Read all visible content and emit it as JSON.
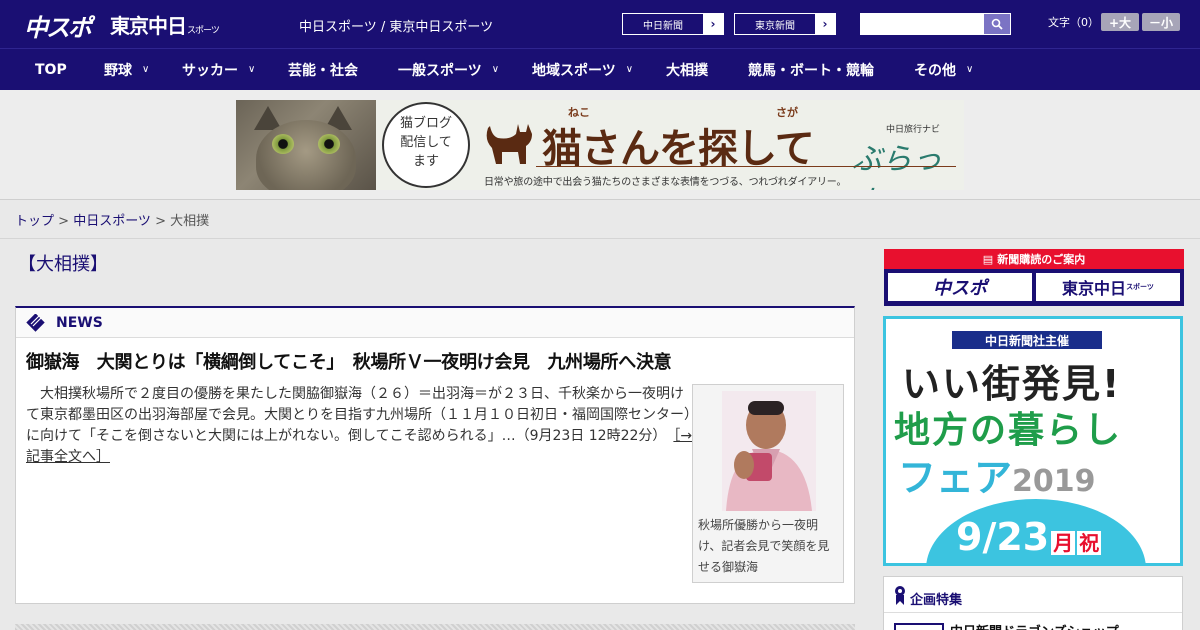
{
  "header": {
    "logo_chuspo": "中スポ",
    "logo_tokyo": "東京中日",
    "logo_tokyo_small": "スポーツ",
    "site_links": "中日スポーツ / 東京中日スポーツ",
    "site_buttons": [
      "中日新聞",
      "東京新聞"
    ],
    "search_placeholder": "",
    "font_size_label": "文字（0）",
    "font_larger": "+大",
    "font_smaller": "－小"
  },
  "nav": {
    "items": [
      {
        "label": "TOP"
      },
      {
        "label": "野球"
      },
      {
        "label": "サッカー"
      },
      {
        "label": "芸能・社会"
      },
      {
        "label": "一般スポーツ"
      },
      {
        "label": "地域スポーツ"
      },
      {
        "label": "大相撲"
      },
      {
        "label": "競馬・ボート・競輪"
      },
      {
        "label": "その他"
      }
    ]
  },
  "banner": {
    "bubble_text": "猫ブログ配信してます",
    "ruby_neko": "ねこ",
    "ruby_saga": "さが",
    "title": "猫さんを探して",
    "brand_sub": "中日旅行ナビ",
    "brand": "ぶらっ人",
    "subtitle": "日常や旅の途中で出会う猫たちのさまざまな表情をつづる、つれづれダイアリー。"
  },
  "breadcrumb": {
    "top": "トップ",
    "sep1": " > ",
    "section": "中日スポーツ",
    "sep2": " > ",
    "current": "大相撲"
  },
  "page_title": "【大相撲】",
  "news": {
    "label": "NEWS",
    "headline": "御嶽海　大関とりは「横綱倒してこそ」　秋場所Ｖ一夜明け会見　九州場所へ決意",
    "body": "大相撲秋場所で２度目の優勝を果たした関脇御嶽海（２６）＝出羽海＝が２３日、千秋楽から一夜明けて東京都墨田区の出羽海部屋で会見。大関とりを目指す九州場所（１１月１０日初日・福岡国際センター）に向けて「そこを倒さないと大関には上がれない。倒してこそ認められる」…（9月23日 12時22分）",
    "more": "［→記事全文へ］",
    "photo_caption": "秋場所優勝から一夜明け、記者会見で笑顔を見せる御嶽海"
  },
  "sidebar": {
    "subscribe_top": "新聞購読のご案内",
    "subscribe_logos": [
      "中スポ",
      "東京中日"
    ],
    "subscribe_small": "スポーツ",
    "fair_tag": "中日新聞社主催",
    "fair_line1": "いい街発見!",
    "fair_line2": "地方の暮らし",
    "fair_line3": "フェア",
    "fair_year": "2019",
    "fair_date": "9/23",
    "fair_month_day": "月",
    "fair_holiday": "祝",
    "special_title": "企画特集",
    "special_item": "中日新聞ドラゴンズショップ"
  },
  "colors": {
    "brand_navy": "#1a0f73",
    "accent_red": "#e8102e",
    "fair_cyan": "#3cc4e0"
  }
}
